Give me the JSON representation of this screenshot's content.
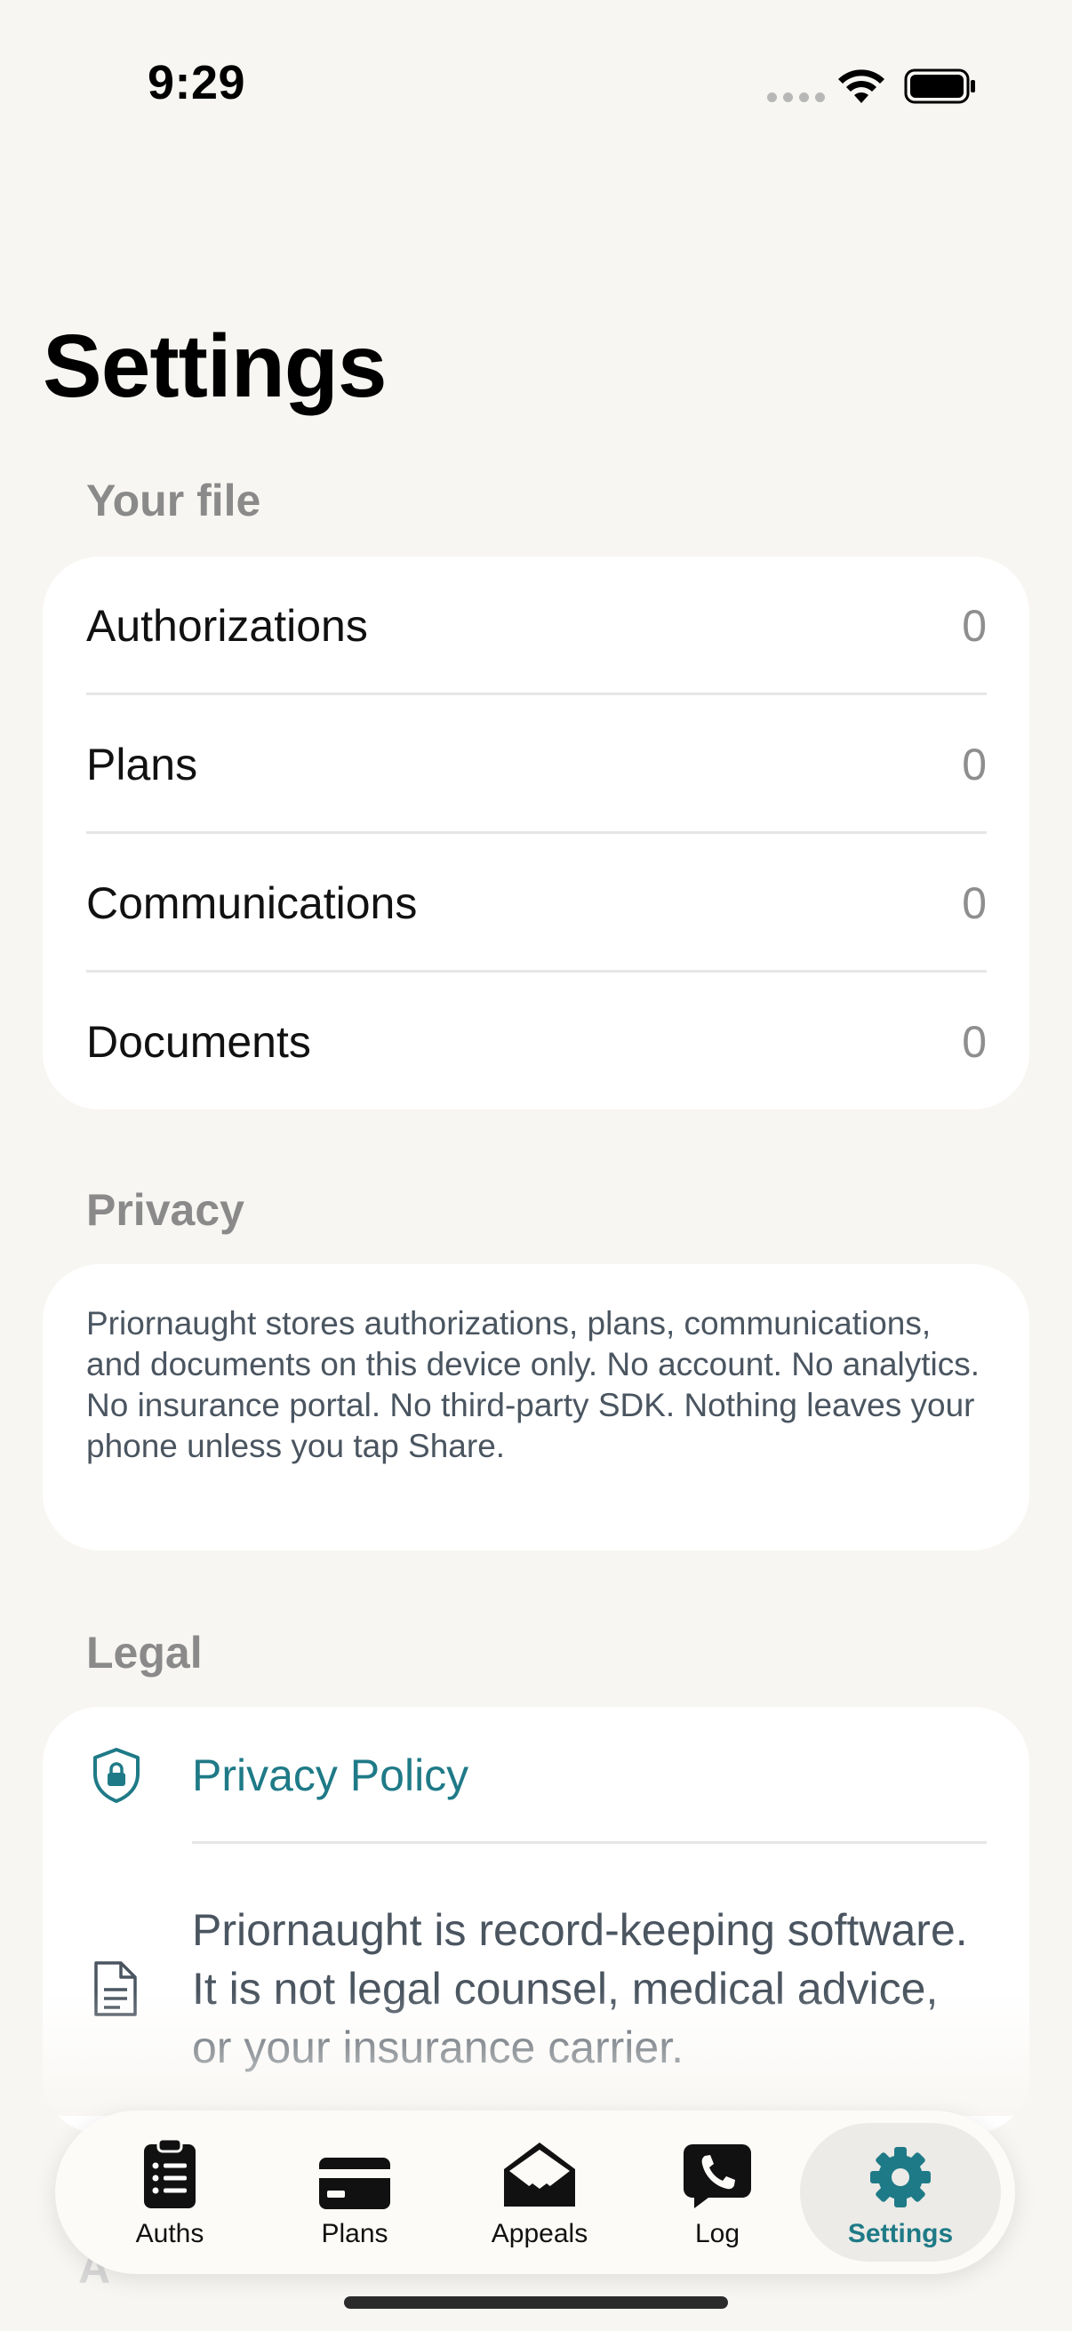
{
  "status_bar": {
    "time": "9:29"
  },
  "title": "Settings",
  "your_file": {
    "header": "Your file",
    "rows": [
      {
        "label": "Authorizations",
        "count": "0"
      },
      {
        "label": "Plans",
        "count": "0"
      },
      {
        "label": "Communications",
        "count": "0"
      },
      {
        "label": "Documents",
        "count": "0"
      }
    ]
  },
  "privacy": {
    "header": "Privacy",
    "text": "Priornaught stores authorizations, plans, communications, and documents on this device only. No account. No analytics. No insurance portal. No third-party SDK. Nothing leaves your phone unless you tap Share."
  },
  "legal": {
    "header": "Legal",
    "policy_label": "Privacy Policy",
    "disclaimer": "Priornaught is record-keeping software. It is not legal counsel, medical advice, or your insurance carrier."
  },
  "tabs": [
    {
      "label": "Auths",
      "icon": "clipboard-list-icon"
    },
    {
      "label": "Plans",
      "icon": "credit-card-icon"
    },
    {
      "label": "Appeals",
      "icon": "envelope-open-icon"
    },
    {
      "label": "Log",
      "icon": "phone-bubble-icon"
    },
    {
      "label": "Settings",
      "icon": "gear-icon",
      "active": true
    }
  ],
  "colors": {
    "accent": "#1f7a87",
    "background": "#f8f6f2",
    "card": "#ffffff",
    "muted": "#8a8a8a"
  }
}
